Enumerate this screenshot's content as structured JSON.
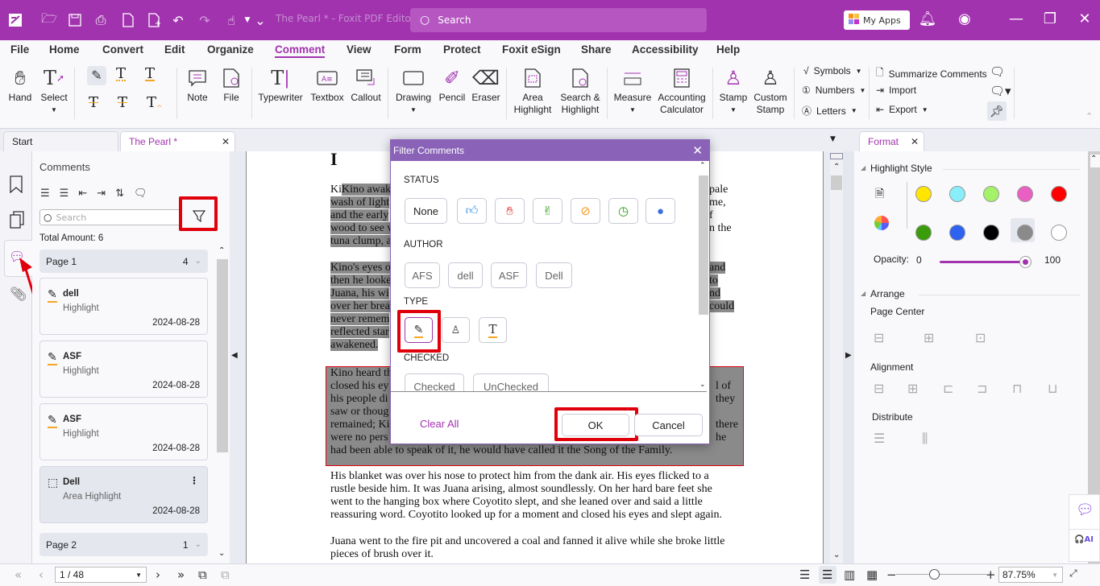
{
  "titlebar": {
    "app_title": "The Pearl * - Foxit PDF Editor",
    "search_placeholder": "Search",
    "my_apps_label": "My Apps",
    "accent_color": "#a233af"
  },
  "menu": [
    "File",
    "Home",
    "Convert",
    "Edit",
    "Organize",
    "Comment",
    "View",
    "Form",
    "Protect",
    "Foxit eSign",
    "Share",
    "Accessibility",
    "Help"
  ],
  "menu_active": "Comment",
  "ribbon": {
    "hand": "Hand",
    "select": "Select",
    "note": "Note",
    "file": "File",
    "typewriter": "Typewriter",
    "textbox": "Textbox",
    "callout": "Callout",
    "drawing": "Drawing",
    "pencil": "Pencil",
    "eraser": "Eraser",
    "area_highlight_1": "Area",
    "area_highlight_2": "Highlight",
    "search_highlight_1": "Search &",
    "search_highlight_2": "Highlight",
    "measure": "Measure",
    "accounting_1": "Accounting",
    "accounting_2": "Calculator",
    "stamp": "Stamp",
    "custom_stamp_1": "Custom",
    "custom_stamp_2": "Stamp",
    "symbols": "Symbols",
    "numbers": "Numbers",
    "letters": "Letters",
    "summarize": "Summarize Comments",
    "import": "Import",
    "export": "Export"
  },
  "tabs": {
    "start": "Start",
    "doc": "The Pearl *",
    "format": "Format"
  },
  "comments_panel": {
    "title": "Comments",
    "search_placeholder": "Search",
    "total": "Total Amount: 6",
    "page1": {
      "label": "Page 1",
      "count": "4"
    },
    "page2": {
      "label": "Page 2",
      "count": "1"
    },
    "items": [
      {
        "author": "dell",
        "type": "Highlight",
        "date": "2024-08-28"
      },
      {
        "author": "ASF",
        "type": "Highlight",
        "date": "2024-08-28"
      },
      {
        "author": "ASF",
        "type": "Highlight",
        "date": "2024-08-28"
      },
      {
        "author": "Dell",
        "type": "Area Highlight",
        "date": "2024-08-28"
      }
    ]
  },
  "document": {
    "heading": "I",
    "p1": [
      "Kino awaken",
      "pale",
      "wash of light",
      "me,",
      "and the early",
      "f",
      "wood to see w",
      "n the",
      "tuna clump, a"
    ],
    "p2": [
      "Kino's eyes o",
      "and",
      "then he looke",
      "to",
      "Juana, his wi",
      "nd",
      "over her brea",
      "could",
      "never remem",
      "reflected star",
      "awakened."
    ],
    "p3": [
      "Kino heard th",
      "closed his ey",
      "l of",
      "his people di",
      "they",
      "saw or thoug",
      "remained; Ki",
      "there",
      "were no pers",
      "he",
      "had been able to speak of it, he would have called it the Song of the Family."
    ],
    "p4": [
      "His blanket was over his nose to protect him from the dank air. His eyes flicked to a",
      "rustle beside him. It was Juana arising, almost soundlessly. On her hard bare feet she",
      "went to the hanging box where Coyotito slept, and she leaned over and said a little",
      "reassuring word. Coyotito looked up for a moment and closed his eyes and slept again."
    ],
    "p5": [
      "Juana went to the fire pit and uncovered a coal and fanned it alive while she broke little",
      "pieces of brush over it."
    ]
  },
  "dialog": {
    "title": "Filter Comments",
    "status_label": "STATUS",
    "status_none": "None",
    "author_label": "AUTHOR",
    "authors": [
      "AFS",
      "dell",
      "ASF",
      "Dell"
    ],
    "type_label": "TYPE",
    "checked_label": "CHECKED",
    "checked": "Checked",
    "unchecked": "UnChecked",
    "clear_all": "Clear All",
    "ok": "OK",
    "cancel": "Cancel"
  },
  "format_panel": {
    "highlight_style": "Highlight Style",
    "colors": [
      "#ffe500",
      "#87eefa",
      "#a3f26a",
      "#ea5fc1",
      "#ff0000",
      "#3a9c0a",
      "#2e62f0",
      "#000000",
      "#8a8a8a",
      "#ffffff"
    ],
    "selected_color": "#8a8a8a",
    "opacity_label": "Opacity:",
    "opacity_min": "0",
    "opacity_max": "100",
    "opacity_value": 100,
    "arrange": "Arrange",
    "page_center": "Page Center",
    "alignment": "Alignment",
    "distribute": "Distribute"
  },
  "statusbar": {
    "page": "1 / 48",
    "zoom": "87.75%"
  }
}
